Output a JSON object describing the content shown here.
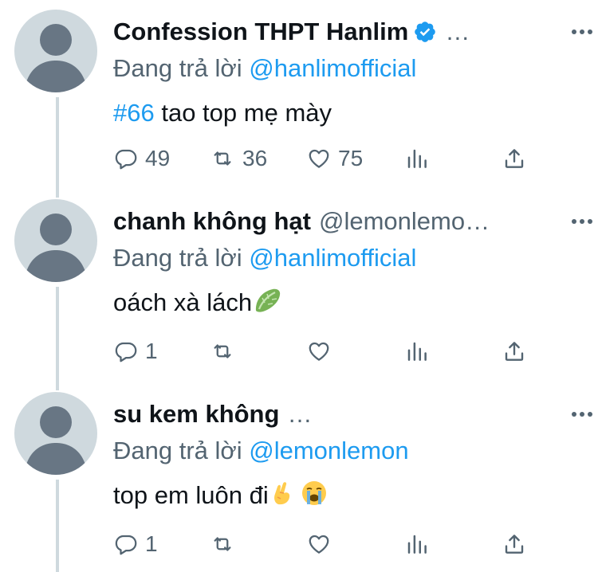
{
  "tweets": [
    {
      "author": "Confession THPT Hanlim",
      "verified": true,
      "handle": "…",
      "reply_prefix": "Đang trả lời",
      "reply_mention": "@hanlimofficial",
      "hashtag": "#66",
      "text": " tao top mẹ mày",
      "emoji": [],
      "replies": "49",
      "retweets": "36",
      "likes": "75"
    },
    {
      "author": "chanh không hạt",
      "verified": false,
      "handle": "@lemonlemo…",
      "reply_prefix": "Đang trả lời",
      "reply_mention": "@hanlimofficial",
      "hashtag": "",
      "text": "oách xà lách",
      "emoji": [
        "lettuce"
      ],
      "replies": "1",
      "retweets": "",
      "likes": ""
    },
    {
      "author": "su kem không",
      "verified": false,
      "handle": "…",
      "reply_prefix": "Đang trả lời",
      "reply_mention": "@lemonlemon",
      "hashtag": "",
      "text": "top em luôn đi",
      "emoji": [
        "crossed-fingers",
        "loudly-crying-face"
      ],
      "replies": "1",
      "retweets": "",
      "likes": ""
    }
  ],
  "icons": {
    "reply": "reply-icon",
    "retweet": "retweet-icon",
    "like": "heart-icon",
    "analytics": "analytics-icon",
    "share": "share-icon",
    "more": "more-icon",
    "verified": "verified-badge-icon"
  },
  "colors": {
    "link": "#1d9bf0",
    "secondary": "#536471",
    "thread_line": "#cfd9de"
  }
}
